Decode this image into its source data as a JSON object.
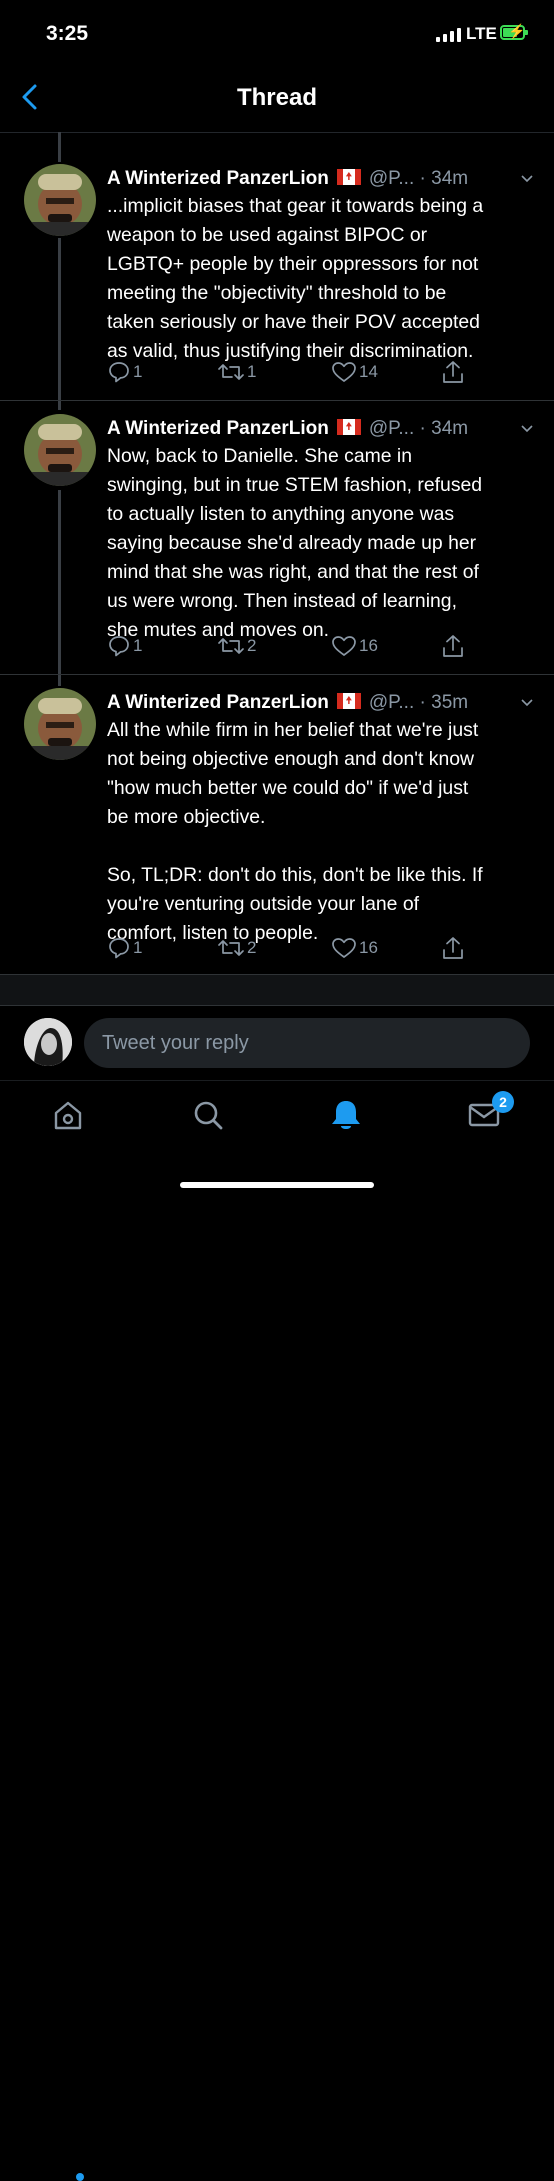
{
  "status_bar": {
    "time": "3:25",
    "network": "LTE",
    "battery_color": "#3ddc55"
  },
  "header": {
    "title": "Thread",
    "back_icon": "chevron-left-icon",
    "accent": "#1d9bf0"
  },
  "tweets": [
    {
      "name": "A Winterized PanzerLion",
      "flag": "canada-flag-icon",
      "handle": "@P...",
      "time": "· 34m",
      "text": "...implicit biases that gear it towards being a\nweapon to be used against BIPOC or\nLGBTQ+ people by their oppressors for not\nmeeting the \"objectivity\" threshold to be\ntaken seriously or have their POV accepted\nas valid, thus justifying their discrimination.",
      "replies": "1",
      "retweets": "1",
      "likes": "14"
    },
    {
      "name": "A Winterized PanzerLion",
      "flag": "canada-flag-icon",
      "handle": "@P...",
      "time": "· 34m",
      "text": "Now, back to Danielle. She came in\nswinging, but in true STEM fashion, refused\nto actually listen to anything anyone was\nsaying because she'd already made up her\nmind that she was right, and that the rest of\nus were wrong. Then instead of learning,\nshe mutes and moves on.",
      "replies": "1",
      "retweets": "2",
      "likes": "16"
    },
    {
      "name": "A Winterized PanzerLion",
      "flag": "canada-flag-icon",
      "handle": "@P...",
      "time": "· 35m",
      "text": "All the while firm in her belief that we're just\nnot being objective enough and don't know\n\"how much better we could do\" if we'd just\nbe more objective.\n\nSo, TL;DR: don't do this, don't be like this. If\nyou're venturing outside your lane of\ncomfort, listen to people.",
      "replies": "1",
      "retweets": "2",
      "likes": "16"
    }
  ],
  "reply_bar": {
    "placeholder": "Tweet your reply"
  },
  "tab_bar": {
    "items": [
      "home-icon",
      "search-icon",
      "notifications-icon",
      "messages-icon"
    ],
    "active": "notifications-icon",
    "messages_badge": "2"
  }
}
